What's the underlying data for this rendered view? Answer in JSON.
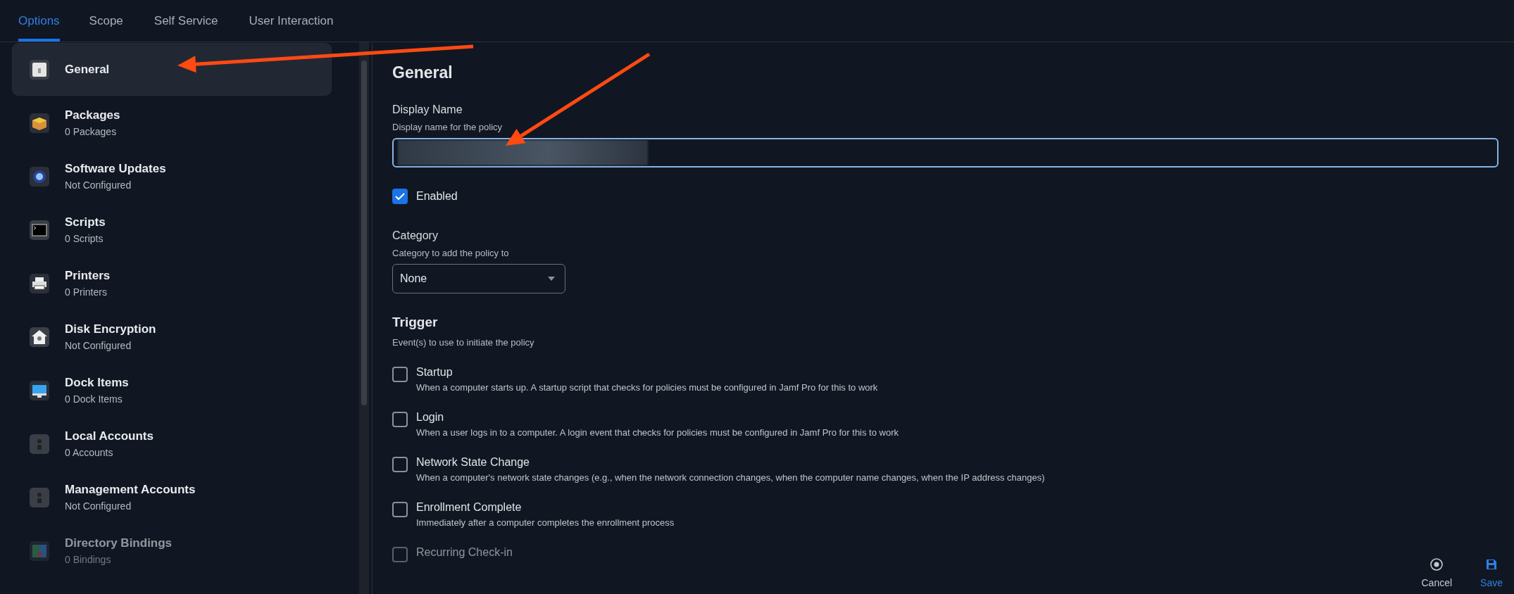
{
  "tabs": [
    {
      "label": "Options",
      "selected": true
    },
    {
      "label": "Scope",
      "selected": false
    },
    {
      "label": "Self Service",
      "selected": false
    },
    {
      "label": "User Interaction",
      "selected": false
    }
  ],
  "sidebar": {
    "items": [
      {
        "title": "General",
        "selected": true,
        "faded": false
      },
      {
        "title": "Packages",
        "subtitle": "0 Packages",
        "selected": false,
        "faded": false
      },
      {
        "title": "Software Updates",
        "subtitle": "Not Configured",
        "selected": false,
        "faded": false
      },
      {
        "title": "Scripts",
        "subtitle": "0 Scripts",
        "selected": false,
        "faded": false
      },
      {
        "title": "Printers",
        "subtitle": "0 Printers",
        "selected": false,
        "faded": false
      },
      {
        "title": "Disk Encryption",
        "subtitle": "Not Configured",
        "selected": false,
        "faded": false
      },
      {
        "title": "Dock Items",
        "subtitle": "0 Dock Items",
        "selected": false,
        "faded": false
      },
      {
        "title": "Local Accounts",
        "subtitle": "0 Accounts",
        "selected": false,
        "faded": false
      },
      {
        "title": "Management Accounts",
        "subtitle": "Not Configured",
        "selected": false,
        "faded": false
      },
      {
        "title": "Directory Bindings",
        "subtitle": "0 Bindings",
        "selected": false,
        "faded": true
      }
    ]
  },
  "form": {
    "heading": "General",
    "display_name": {
      "label": "Display Name",
      "help": "Display name for the policy",
      "redacted": true,
      "focused": true
    },
    "enabled": {
      "label": "Enabled",
      "checked": true
    },
    "category": {
      "label": "Category",
      "help": "Category to add the policy to",
      "value": "None"
    },
    "trigger": {
      "label": "Trigger",
      "help": "Event(s) to use to initiate the policy",
      "options": [
        {
          "label": "Startup",
          "description": "When a computer starts up. A startup script that checks for policies must be configured in Jamf Pro for this to work",
          "checked": false,
          "faded": false
        },
        {
          "label": "Login",
          "description": "When a user logs in to a computer. A login event that checks for policies must be configured in Jamf Pro for this to work",
          "checked": false,
          "faded": false
        },
        {
          "label": "Network State Change",
          "description": "When a computer's network state changes (e.g., when the network connection changes, when the computer name changes, when the IP address changes)",
          "checked": false,
          "faded": false
        },
        {
          "label": "Enrollment Complete",
          "description": "Immediately after a computer completes the enrollment process",
          "checked": false,
          "faded": false
        },
        {
          "label": "Recurring Check-in",
          "checked": false,
          "faded": true
        }
      ]
    }
  },
  "actions": [
    {
      "kind": "cancel",
      "label": "Cancel"
    },
    {
      "kind": "save",
      "label": "Save"
    }
  ],
  "annotations": [
    {
      "kind": "arrow"
    },
    {
      "kind": "arrow"
    }
  ]
}
